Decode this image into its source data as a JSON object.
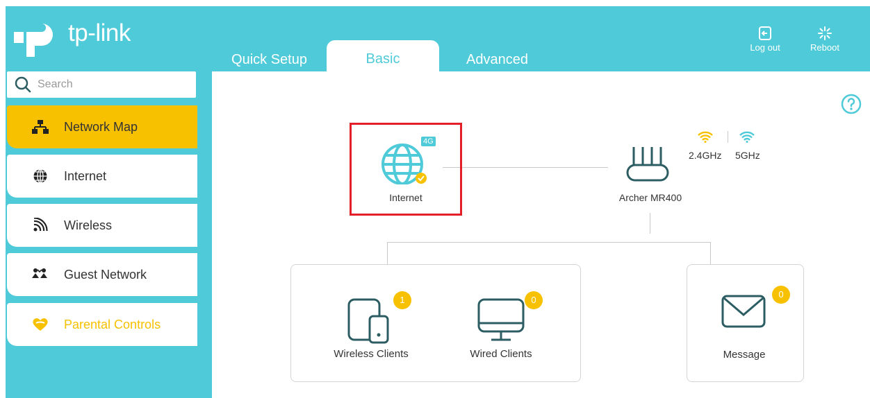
{
  "header": {
    "brand": "tp-link",
    "tabs": [
      {
        "label": "Quick Setup",
        "active": false
      },
      {
        "label": "Basic",
        "active": true
      },
      {
        "label": "Advanced",
        "active": false
      }
    ],
    "logout_label": "Log out",
    "reboot_label": "Reboot"
  },
  "sidebar": {
    "search_placeholder": "Search",
    "items": [
      {
        "label": "Network Map",
        "icon": "network-map-icon",
        "active": true
      },
      {
        "label": "Internet",
        "icon": "globe-icon",
        "active": false
      },
      {
        "label": "Wireless",
        "icon": "wireless-icon",
        "active": false
      },
      {
        "label": "Guest Network",
        "icon": "guest-network-icon",
        "active": false
      },
      {
        "label": "Parental Controls",
        "icon": "heart-icon",
        "active": false
      }
    ]
  },
  "map": {
    "internet_label": "Internet",
    "internet_badge": "4G",
    "router_label": "Archer MR400",
    "band_24": "2.4GHz",
    "band_5": "5GHz",
    "wireless_clients_label": "Wireless Clients",
    "wireless_clients_count": "1",
    "wired_clients_label": "Wired Clients",
    "wired_clients_count": "0",
    "message_label": "Message",
    "message_count": "0"
  },
  "colors": {
    "brand": "#4fcad8",
    "accent": "#f7c100",
    "highlight": "#e3202a",
    "icon_dark": "#2c5d63"
  }
}
